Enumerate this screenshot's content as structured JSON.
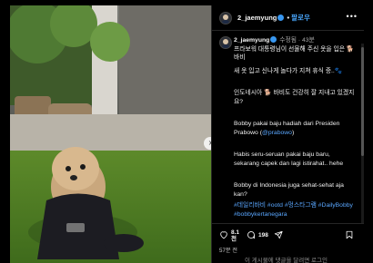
{
  "post": {
    "username": "2_jaemyung",
    "separator": " • ",
    "follow": "팔로우",
    "more": "•••",
    "next": "›"
  },
  "caption": {
    "username": "2_jaemyung",
    "edited": "수정됨",
    "time": "43분",
    "line1": "프라보워 대통령님이 선물해 주신 옷을 입은 🐕 바비",
    "line2": "새 옷 입고 신나게 놀다가 지쳐 휴식 중..🐾",
    "line3": "인도네시아 🐕 바비도 건강히 잘 지내고 있겠지요?",
    "line4": "Bobby pakai baju hadiah dari Presiden Prabowo (",
    "mention": "@prabowo",
    "line4_end": ")",
    "line5": "Habis seru-seruan pakai baju baru, sekarang capek dan lagi istirahat.. hehe",
    "line6": "Bobby di Indonesia juga sehat-sehat aja kan?",
    "tags": "#데일리바비 #ootd #멍스타그램 #DailyBobby #bobbykertanegara"
  },
  "actions": {
    "like_icon": "heart-icon",
    "like_count": "8.1천",
    "comment_icon": "comment-icon",
    "comment_count": "198",
    "share_icon": "share-icon",
    "save_icon": "bookmark-icon",
    "time_ago": "57분 전",
    "comment_placeholder": "이 게시물에 댓글을 달려면 로그인"
  },
  "colors": {
    "background": "#000000",
    "link": "#4aa8ff",
    "verified": "#3897f0",
    "muted": "#a8a8a8"
  }
}
